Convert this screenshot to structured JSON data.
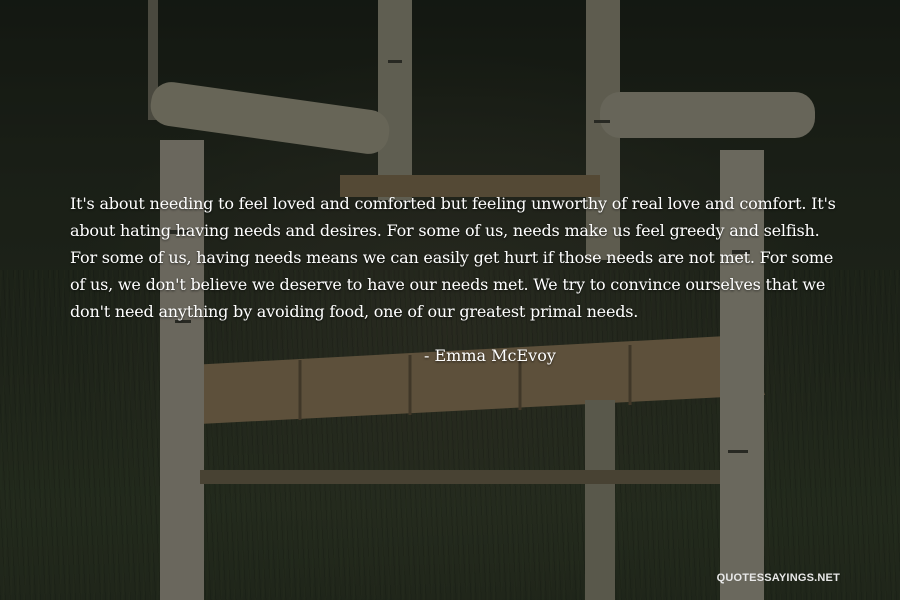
{
  "quote": {
    "text": "It's about needing to feel loved and comforted but feeling unworthy of real love and comfort. It's about hating having needs and desires. For some of us, needs make us feel greedy and selfish. For some of us, having needs means we can easily get hurt if those needs are not met. For some of us, we don't believe we deserve to have our needs met. We try to convince ourselves that we don't need anything by avoiding food, one of our greatest primal needs.",
    "author": "- Emma McEvoy"
  },
  "watermark": {
    "text": "QUOTESSAYINGS.NET"
  }
}
